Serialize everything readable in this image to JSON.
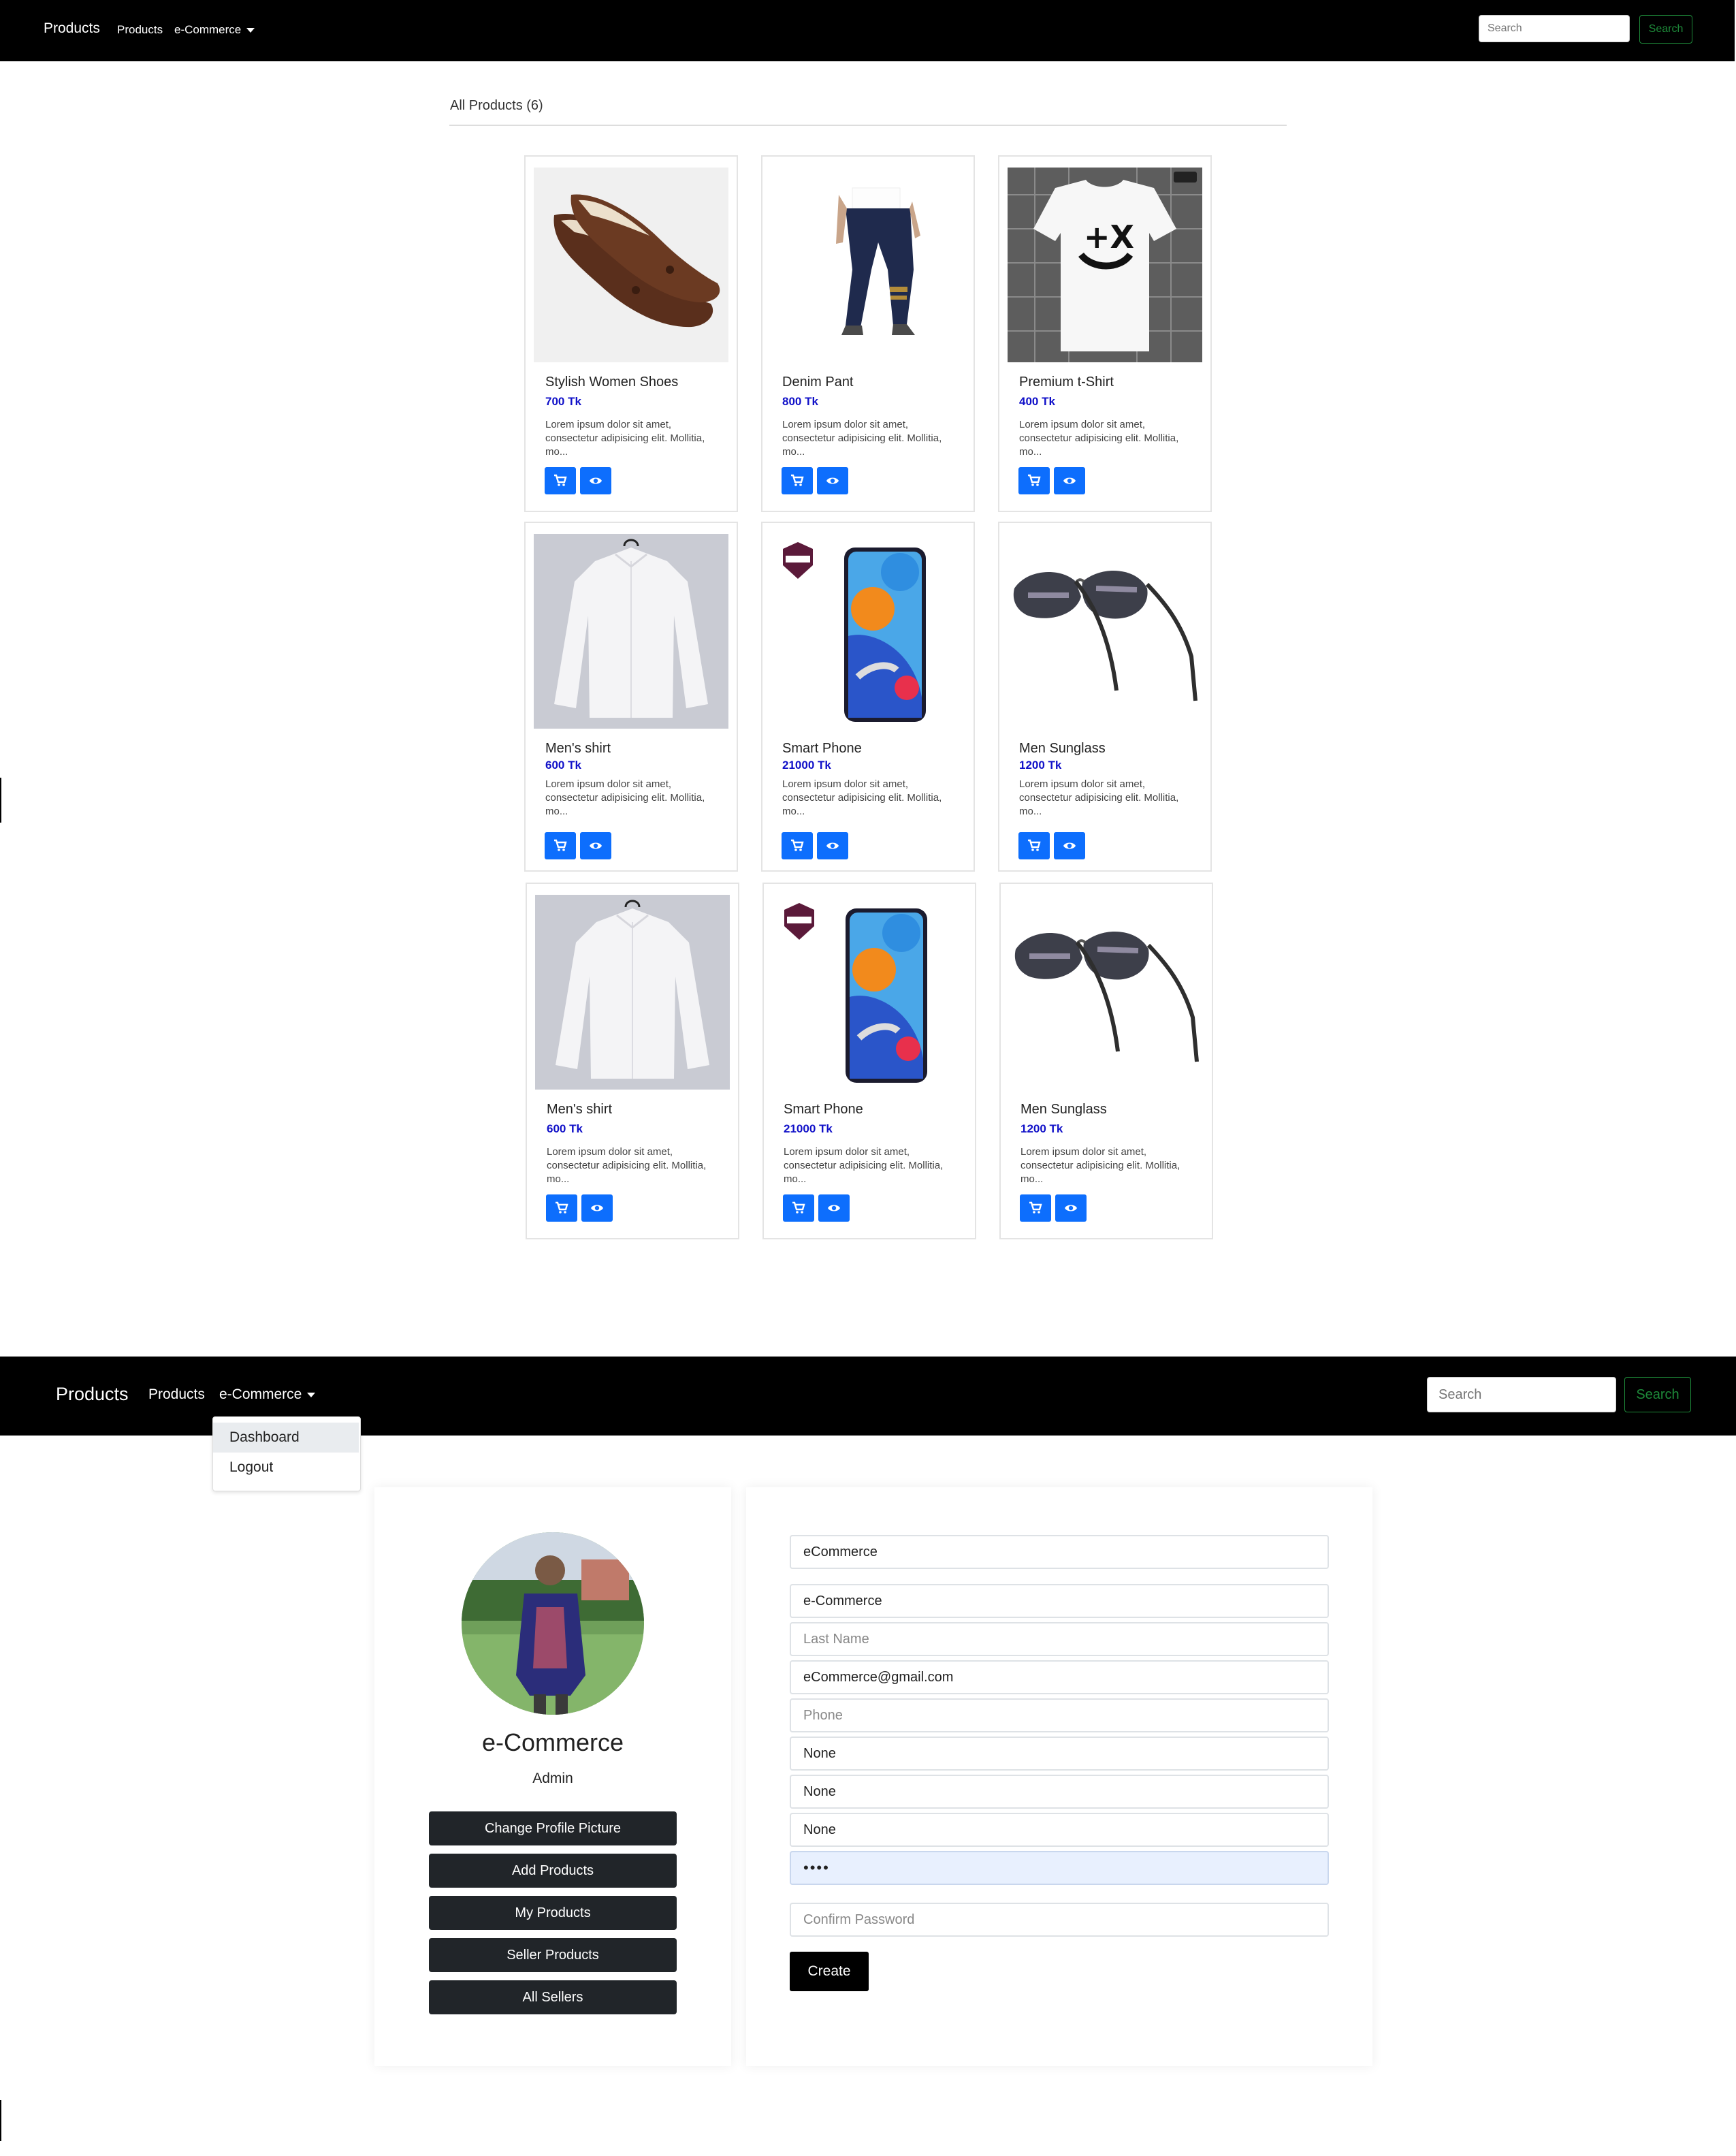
{
  "navbar_top": {
    "brand": "Products",
    "links": [
      "Products",
      "e-Commerce"
    ],
    "search_placeholder": "Search",
    "search_button": "Search"
  },
  "products_section": {
    "title": "All Products (6)",
    "products": [
      {
        "name": "Stylish Women Shoes",
        "price": "700 Tk",
        "description": "Lorem ipsum dolor sit amet, consectetur adipisicing elit. Mollitia, mo..."
      },
      {
        "name": "Denim Pant",
        "price": "800 Tk",
        "description": "Lorem ipsum dolor sit amet, consectetur adipisicing elit. Mollitia, mo..."
      },
      {
        "name": "Premium t-Shirt",
        "price": "400 Tk",
        "description": "Lorem ipsum dolor sit amet, consectetur adipisicing elit. Mollitia, mo..."
      },
      {
        "name": "Men's shirt",
        "price": "600 Tk",
        "description": "Lorem ipsum dolor sit amet, consectetur adipisicing elit. Mollitia, mo..."
      },
      {
        "name": "Smart Phone",
        "price": "21000 Tk",
        "description": "Lorem ipsum dolor sit amet, consectetur adipisicing elit. Mollitia, mo..."
      },
      {
        "name": "Men Sunglass",
        "price": "1200 Tk",
        "description": "Lorem ipsum dolor sit amet, consectetur adipisicing elit. Mollitia, mo..."
      },
      {
        "name": "Men's shirt",
        "price": "600 Tk",
        "description": "Lorem ipsum dolor sit amet, consectetur adipisicing elit. Mollitia, mo..."
      },
      {
        "name": "Smart Phone",
        "price": "21000 Tk",
        "description": "Lorem ipsum dolor sit amet, consectetur adipisicing elit. Mollitia, mo..."
      },
      {
        "name": "Men Sunglass",
        "price": "1200 Tk",
        "description": "Lorem ipsum dolor sit amet, consectetur adipisicing elit. Mollitia, mo..."
      }
    ],
    "icons": {
      "cart": "cart-icon",
      "view": "eye-icon"
    },
    "button_color": "#0d6efd",
    "price_color": "#1010c8"
  },
  "navbar_bottom": {
    "brand": "Products",
    "links": [
      "Products",
      "e-Commerce"
    ],
    "dropdown_items": [
      "Dashboard",
      "Logout"
    ],
    "search_placeholder": "Search",
    "search_button": "Search"
  },
  "profile": {
    "name": "e-Commerce",
    "role": "Admin",
    "buttons": [
      "Change Profile Picture",
      "Add Products",
      "My Products",
      "Seller Products",
      "All Sellers"
    ]
  },
  "form": {
    "fields": [
      {
        "value": "eCommerce",
        "placeholder": ""
      },
      {
        "value": "e-Commerce",
        "placeholder": ""
      },
      {
        "value": "",
        "placeholder": "Last Name"
      },
      {
        "value": "eCommerce@gmail.com",
        "placeholder": ""
      },
      {
        "value": "",
        "placeholder": "Phone"
      },
      {
        "value": "None",
        "placeholder": ""
      },
      {
        "value": "None",
        "placeholder": ""
      },
      {
        "value": "None",
        "placeholder": ""
      },
      {
        "value": "••••",
        "placeholder": ""
      },
      {
        "value": "",
        "placeholder": "Confirm Password"
      }
    ],
    "submit": "Create"
  }
}
